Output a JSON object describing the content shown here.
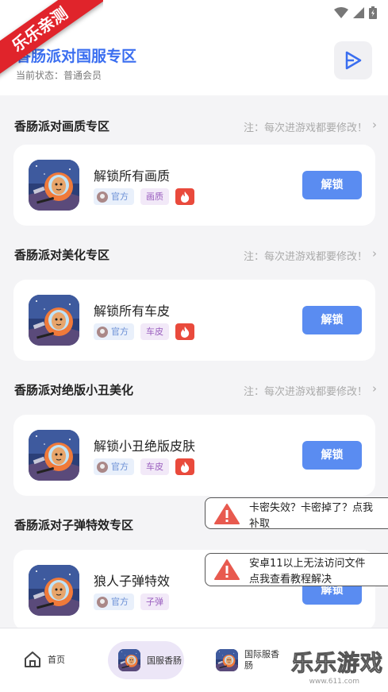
{
  "ribbon": {
    "text": "乐乐亲测"
  },
  "header": {
    "title": "香肠派对国服专区",
    "status": "当前状态：普通会员"
  },
  "note_text": "注：每次进游戏都要修改！",
  "sections": [
    {
      "title": "香肠派对画质专区",
      "note": "注：每次进游戏都要修改！"
    },
    {
      "title": "香肠派对美化专区",
      "note": "注：每次进游戏都要修改！"
    },
    {
      "title": "香肠派对绝版小丑美化",
      "note": "注：每次进游戏都要修改！"
    },
    {
      "title": "香肠派对子弹特效专区",
      "note": ""
    }
  ],
  "cards": [
    {
      "title": "解锁所有画质",
      "official": "官方",
      "category": "画质",
      "button": "解锁",
      "hot": true
    },
    {
      "title": "解锁所有车皮",
      "official": "官方",
      "category": "车皮",
      "button": "解锁",
      "hot": true
    },
    {
      "title": "解锁小丑绝版皮肤",
      "official": "官方",
      "category": "车皮",
      "button": "解锁",
      "hot": true
    },
    {
      "title": "狼人子弹特效",
      "official": "官方",
      "category": "子弹",
      "button": "解锁",
      "hot": false
    }
  ],
  "toasts": [
    {
      "line1": "卡密失效？卡密掉了？点我",
      "line2": "补取"
    },
    {
      "line1": "安卓11以上无法访问文件",
      "line2": "点我查看教程解决"
    }
  ],
  "nav": {
    "home": "首页",
    "cn": "国服香肠",
    "intl_line1": "国际服香",
    "intl_line2": "肠"
  },
  "watermark": {
    "text": "乐乐游戏",
    "url": "www.611.com"
  },
  "colors": {
    "accent": "#3a6ef0",
    "button": "#5a8cf1",
    "hot": "#e94a3c",
    "ribbon": "#e0242b"
  }
}
